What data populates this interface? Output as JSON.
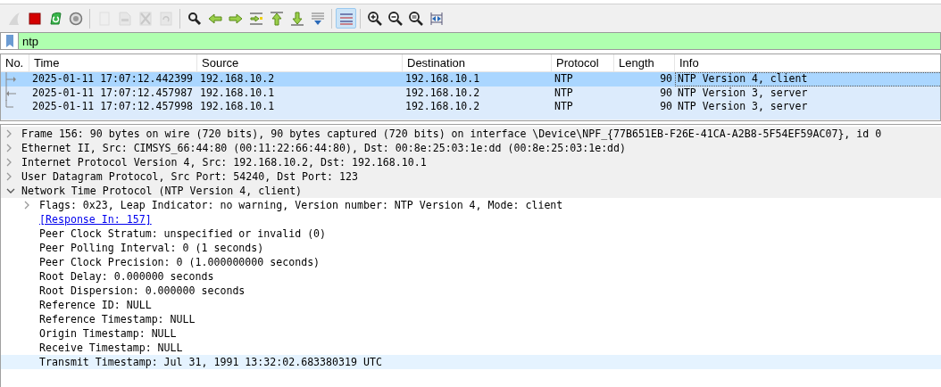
{
  "toolbar": [
    [
      {
        "disabled": true,
        "pressed": false
      },
      {
        "disabled": false,
        "pressed": false
      },
      {
        "disabled": false,
        "pressed": false
      },
      {
        "disabled": false,
        "pressed": false
      }
    ],
    [
      {
        "disabled": true,
        "pressed": false
      },
      {
        "disabled": true,
        "pressed": false
      },
      {
        "disabled": true,
        "pressed": false
      },
      {
        "disabled": true,
        "pressed": false
      }
    ],
    [
      {
        "disabled": false,
        "pressed": false
      },
      {
        "disabled": false,
        "pressed": false
      },
      {
        "disabled": false,
        "pressed": false
      },
      {
        "disabled": false,
        "pressed": false
      },
      {
        "disabled": false,
        "pressed": false
      },
      {
        "disabled": false,
        "pressed": false
      },
      {
        "disabled": false,
        "pressed": false
      }
    ],
    [
      {
        "disabled": false,
        "pressed": true
      }
    ],
    [
      {
        "disabled": false,
        "pressed": false
      },
      {
        "disabled": false,
        "pressed": false
      },
      {
        "disabled": false,
        "pressed": false
      },
      {
        "disabled": false,
        "pressed": false
      }
    ]
  ],
  "filter": {
    "value": "ntp"
  },
  "packet_list": {
    "columns": [
      "No.",
      "Time",
      "Source",
      "Destination",
      "Protocol",
      "Length",
      "Info"
    ],
    "rows": [
      {
        "kind": "request",
        "selected": true,
        "time": "2025-01-11 17:07:12.442399",
        "source": "192.168.10.2",
        "destination": "192.168.10.1",
        "protocol": "NTP",
        "length": "90",
        "info": "NTP Version 4, client"
      },
      {
        "kind": "response",
        "selected": false,
        "time": "2025-01-11 17:07:12.457987",
        "source": "192.168.10.1",
        "destination": "192.168.10.2",
        "protocol": "NTP",
        "length": "90",
        "info": "NTP Version 3, server"
      },
      {
        "kind": "end",
        "selected": false,
        "time": "2025-01-11 17:07:12.457998",
        "source": "192.168.10.1",
        "destination": "192.168.10.2",
        "protocol": "NTP",
        "length": "90",
        "info": "NTP Version 3, server"
      }
    ]
  },
  "details": [
    {
      "kind": "branch",
      "expanded": false,
      "selected": false,
      "text": "Frame 156: 90 bytes on wire (720 bits), 90 bytes captured (720 bits) on interface \\Device\\NPF_{77B651EB-F26E-41CA-A2B8-5F54EF59AC07}, id 0"
    },
    {
      "kind": "branch",
      "expanded": false,
      "selected": false,
      "text": "Ethernet II, Src: CIMSYS_66:44:80 (00:11:22:66:44:80), Dst: 00:8e:25:03:1e:dd (00:8e:25:03:1e:dd)"
    },
    {
      "kind": "branch",
      "expanded": false,
      "selected": false,
      "text": "Internet Protocol Version 4, Src: 192.168.10.2, Dst: 192.168.10.1"
    },
    {
      "kind": "branch",
      "expanded": false,
      "selected": false,
      "text": "User Datagram Protocol, Src Port: 54240, Dst Port: 123"
    },
    {
      "kind": "branch",
      "expanded": true,
      "selected": false,
      "text": "Network Time Protocol (NTP Version 4, client)",
      "children": [
        {
          "kind": "branch",
          "expanded": false,
          "selected": false,
          "text": "Flags: 0x23, Leap Indicator: no warning, Version number: NTP Version 4, Mode: client"
        },
        {
          "kind": "link",
          "selected": false,
          "text": "[Response In: 157]"
        },
        {
          "kind": "leaf",
          "selected": false,
          "text": "Peer Clock Stratum: unspecified or invalid (0)"
        },
        {
          "kind": "leaf",
          "selected": false,
          "text": "Peer Polling Interval: 0 (1 seconds)"
        },
        {
          "kind": "leaf",
          "selected": false,
          "text": "Peer Clock Precision: 0 (1.000000000 seconds)"
        },
        {
          "kind": "leaf",
          "selected": false,
          "text": "Root Delay: 0.000000 seconds"
        },
        {
          "kind": "leaf",
          "selected": false,
          "text": "Root Dispersion: 0.000000 seconds"
        },
        {
          "kind": "leaf",
          "selected": false,
          "text": "Reference ID: NULL"
        },
        {
          "kind": "leaf",
          "selected": false,
          "text": "Reference Timestamp: NULL"
        },
        {
          "kind": "leaf",
          "selected": false,
          "text": "Origin Timestamp: NULL"
        },
        {
          "kind": "leaf",
          "selected": false,
          "text": "Receive Timestamp: NULL"
        },
        {
          "kind": "leaf",
          "selected": true,
          "text": "Transmit Timestamp: Jul 31, 1991 13:32:02.683380319 UTC"
        }
      ]
    }
  ]
}
